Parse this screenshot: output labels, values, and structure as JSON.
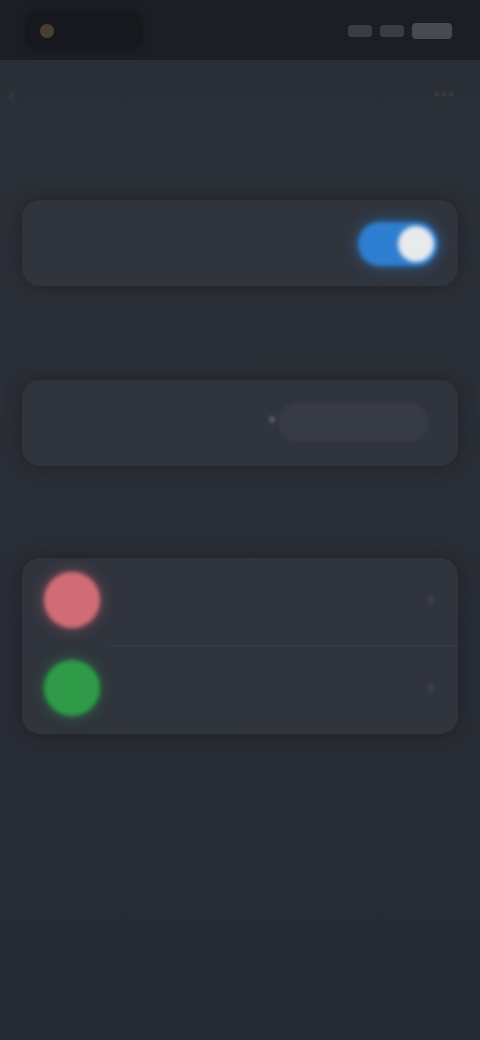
{
  "status_bar": {
    "time": ""
  },
  "nav": {
    "title": "",
    "back_icon": "chevron-left-icon",
    "action_icon": "more-icon"
  },
  "sections": {
    "first": {
      "header": "",
      "row_label": "",
      "toggle_on": true
    },
    "second": {
      "header": "",
      "row_label": "",
      "select_value": ""
    },
    "third": {
      "header": "",
      "items": [
        {
          "label": "",
          "avatar_color": "#d26c76"
        },
        {
          "label": "",
          "avatar_color": "#2f9a48"
        }
      ]
    }
  },
  "colors": {
    "accent": "#2e7fd1",
    "section_header": "#5a79ad",
    "background": "#262a33",
    "card": "#30343d"
  }
}
